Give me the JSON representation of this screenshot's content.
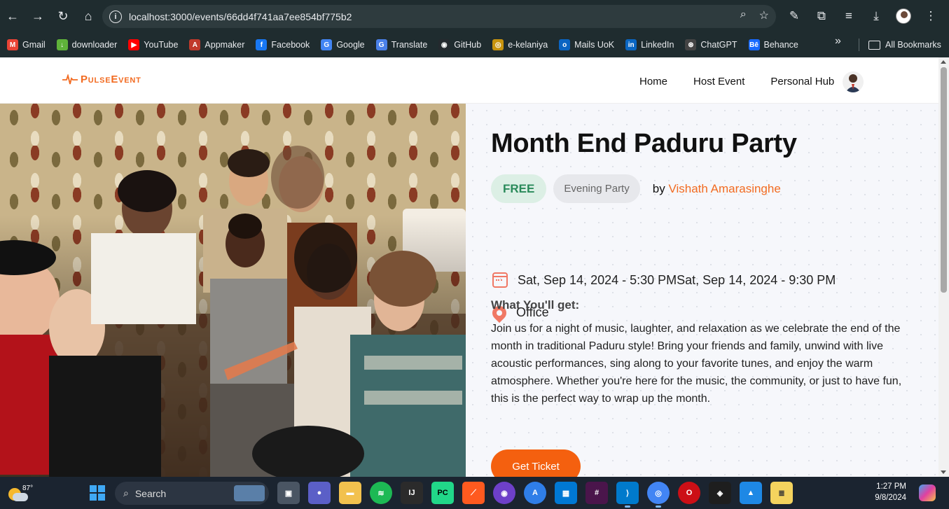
{
  "browser": {
    "url": "localhost:3000/events/66dd4f741aa7ee854bf775b2",
    "bookmarks": [
      {
        "label": "Gmail",
        "icon": "gmail-icon",
        "color": "#ea4335",
        "glyph": "M"
      },
      {
        "label": "downloader",
        "icon": "download-icon",
        "color": "#5fb33a",
        "glyph": "↓"
      },
      {
        "label": "YouTube",
        "icon": "youtube-icon",
        "color": "#ff0000",
        "glyph": "▶"
      },
      {
        "label": "Appmaker",
        "icon": "appmaker-icon",
        "color": "#c0392b",
        "glyph": "A"
      },
      {
        "label": "Facebook",
        "icon": "facebook-icon",
        "color": "#1877f2",
        "glyph": "f"
      },
      {
        "label": "Google",
        "icon": "google-icon",
        "color": "#4285f4",
        "glyph": "G"
      },
      {
        "label": "Translate",
        "icon": "translate-icon",
        "color": "#4a80e8",
        "glyph": "G"
      },
      {
        "label": "GitHub",
        "icon": "github-icon",
        "color": "#24292e",
        "glyph": "◉"
      },
      {
        "label": "e-kelaniya",
        "icon": "ekelaniya-icon",
        "color": "#c8940e",
        "glyph": "◎"
      },
      {
        "label": "Mails UoK",
        "icon": "outlook-icon",
        "color": "#0a64c2",
        "glyph": "o"
      },
      {
        "label": "LinkedIn",
        "icon": "linkedin-icon",
        "color": "#0a66c2",
        "glyph": "in"
      },
      {
        "label": "ChatGPT",
        "icon": "chatgpt-icon",
        "color": "#444",
        "glyph": "⊛"
      },
      {
        "label": "Behance",
        "icon": "behance-icon",
        "color": "#1769ff",
        "glyph": "Bē"
      }
    ],
    "all_bookmarks": "All Bookmarks"
  },
  "site": {
    "logo": "PulseEvent",
    "nav": [
      "Home",
      "Host Event",
      "Personal Hub"
    ]
  },
  "event": {
    "title": "Month End Paduru Party",
    "price": "FREE",
    "category": "Evening Party",
    "by": "by",
    "host": "Vishath Amarasinghe",
    "datetime": "Sat, Sep 14, 2024 - 5:30 PMSat, Sep 14, 2024 - 9:30 PM",
    "location": "Office",
    "subtitle": "What You'll get:",
    "description": "Join us for a night of music, laughter, and relaxation as we celebrate the end of the month in traditional Paduru style! Bring your friends and family, unwind with live acoustic performances, sing along to your favorite tunes, and enjoy the warm atmosphere. Whether you're here for the music, the community, or just to have fun, this is the perfect way to wrap up the month.",
    "cta": "Get Ticket"
  },
  "taskbar": {
    "temperature": "87°",
    "search": "Search",
    "time": "1:27 PM",
    "date": "9/8/2024"
  },
  "colors": {
    "accent": "#f4600f",
    "free_bg": "#dcefe5",
    "free_text": "#2a8a5a"
  }
}
